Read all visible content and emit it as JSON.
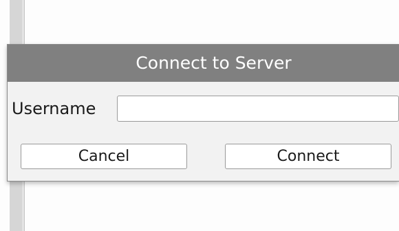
{
  "dialog": {
    "title": "Connect to Server",
    "username_label": "Username",
    "username_value": "",
    "username_placeholder": "",
    "cancel_label": "Cancel",
    "connect_label": "Connect"
  },
  "colors": {
    "titlebar_bg": "#808080",
    "titlebar_text": "#ffffff",
    "dialog_bg": "#f2f2f2",
    "button_bg": "#ffffff"
  }
}
